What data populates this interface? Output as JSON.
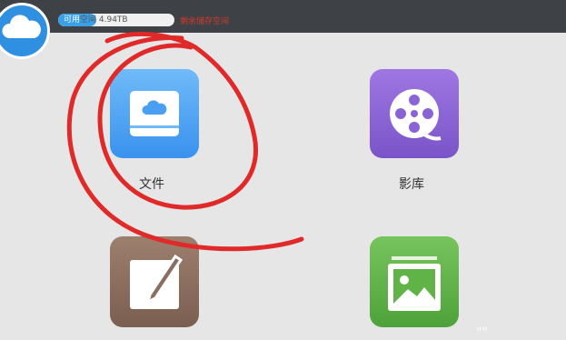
{
  "storage": {
    "used_label": "可用",
    "value_label": "空间 4.94TB",
    "fill_fraction": 0.33
  },
  "top_note": "剩余储存空间",
  "apps": [
    {
      "label": "文件",
      "icon": "folder-cloud-icon"
    },
    {
      "label": "影库",
      "icon": "film-reel-icon"
    },
    {
      "label": "",
      "icon": "notepad-pen-icon"
    },
    {
      "label": "",
      "icon": "photo-gallery-icon"
    }
  ],
  "colors": {
    "accent": "#3aa0e8",
    "files": "#4a9ff2",
    "video": "#8a63d4",
    "notes": "#8a6e60",
    "photos": "#5fb347",
    "annotation": "#e02a2a"
  }
}
